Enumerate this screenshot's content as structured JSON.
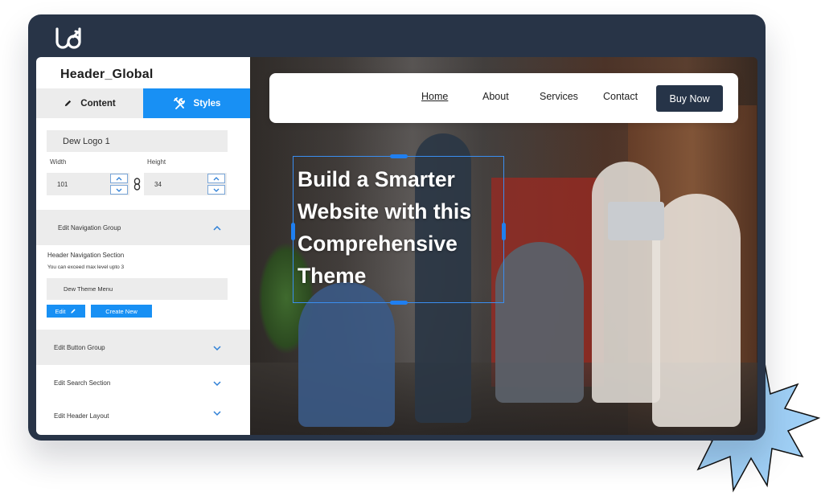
{
  "colors": {
    "frame": "#283447",
    "accent": "#1890f4",
    "buy_button": "#263448",
    "starburst_fill": "#9fcff5"
  },
  "app": {
    "logo_icon": "brand-logo-icon"
  },
  "sidebar": {
    "title": "Header_Global",
    "tabs": [
      {
        "label": "Content",
        "icon": "pencil-icon",
        "active": false
      },
      {
        "label": "Styles",
        "icon": "tools-icon",
        "active": true
      }
    ],
    "logo_field": {
      "value": "Dew Logo 1"
    },
    "width": {
      "label": "Width",
      "value": "101"
    },
    "height": {
      "label": "Height",
      "value": "34"
    },
    "nav_group": {
      "label": "Edit Navigation Group",
      "section_label": "Header Navigation Section",
      "hint": "You can exceed max level upto 3",
      "menu_value": "Dew Theme Menu",
      "edit_label": "Edit",
      "create_label": "Create New"
    },
    "groups": [
      {
        "label": "Edit Button Group"
      },
      {
        "label": "Edit Search Section"
      },
      {
        "label": "Edit Header Layout"
      }
    ]
  },
  "preview": {
    "nav_links": [
      "Home",
      "About",
      "Services",
      "Contact"
    ],
    "cta": "Buy Now",
    "headline": "Build a Smarter Website with this Comprehensive Theme"
  }
}
